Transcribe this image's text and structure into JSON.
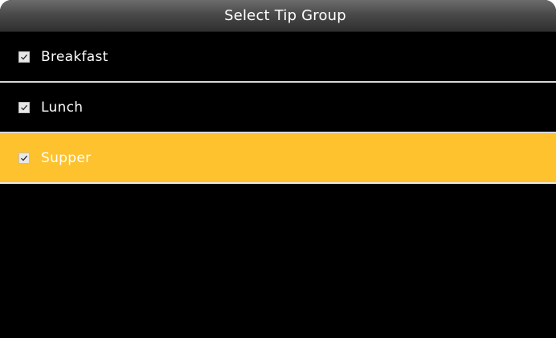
{
  "header": {
    "title": "Select Tip Group"
  },
  "colors": {
    "background": "#000000",
    "selected_row": "#fdc22d",
    "separator": "#d9d9d9",
    "text": "#ffffff"
  },
  "items": [
    {
      "label": "Breakfast",
      "checked": true,
      "selected": false,
      "icon": "checkbox-checked-icon"
    },
    {
      "label": "Lunch",
      "checked": true,
      "selected": false,
      "icon": "checkbox-checked-icon"
    },
    {
      "label": "Supper",
      "checked": true,
      "selected": true,
      "icon": "checkbox-checked-icon"
    }
  ]
}
